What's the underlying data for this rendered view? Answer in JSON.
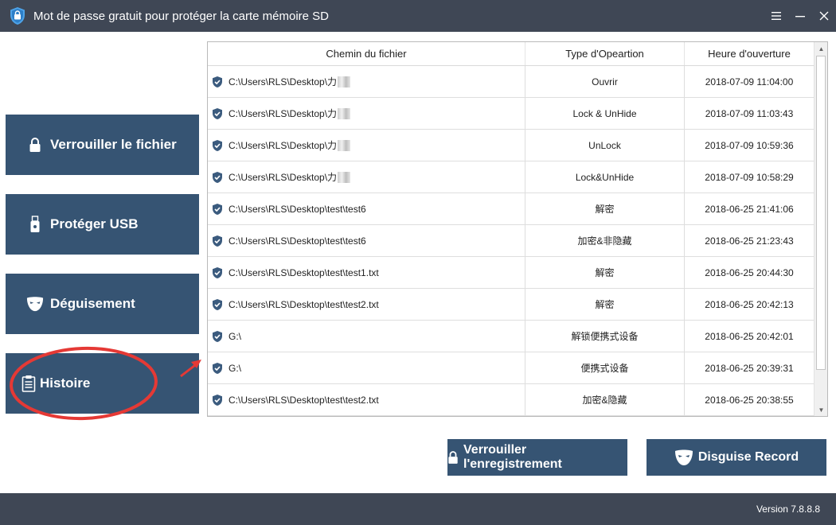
{
  "window": {
    "title": "Mot de passe gratuit pour protéger la carte mémoire SD",
    "icon": "shield-folder-icon",
    "controls": {
      "menu": "≡",
      "minimize": "—",
      "close": "✕"
    }
  },
  "sidebar": {
    "items": [
      {
        "label": "Verrouiller le fichier",
        "icon": "lock-icon"
      },
      {
        "label": "Protéger USB",
        "icon": "usb-icon"
      },
      {
        "label": "Déguisement",
        "icon": "mask-icon"
      },
      {
        "label": "Histoire",
        "icon": "clipboard-icon",
        "selected": true
      }
    ]
  },
  "table": {
    "headers": {
      "path": "Chemin du fichier",
      "type": "Type d'Opeartion",
      "time": "Heure d'ouverture"
    },
    "rows": [
      {
        "path": "C:\\Users\\RLS\\Desktop\\力",
        "type": "Ouvrir",
        "time": "2018-07-09 11:04:00",
        "blurred": true
      },
      {
        "path": "C:\\Users\\RLS\\Desktop\\力",
        "type": "Lock & UnHide",
        "time": "2018-07-09 11:03:43",
        "blurred": true
      },
      {
        "path": "C:\\Users\\RLS\\Desktop\\力",
        "type": "UnLock",
        "time": "2018-07-09 10:59:36",
        "blurred": true
      },
      {
        "path": "C:\\Users\\RLS\\Desktop\\力",
        "type": "Lock&UnHide",
        "time": "2018-07-09 10:58:29",
        "blurred": true
      },
      {
        "path": "C:\\Users\\RLS\\Desktop\\test\\test6",
        "type": "解密",
        "time": "2018-06-25 21:41:06"
      },
      {
        "path": "C:\\Users\\RLS\\Desktop\\test\\test6",
        "type": "加密&非隐藏",
        "time": "2018-06-25 21:23:43"
      },
      {
        "path": "C:\\Users\\RLS\\Desktop\\test\\test1.txt",
        "type": "解密",
        "time": "2018-06-25 20:44:30"
      },
      {
        "path": "C:\\Users\\RLS\\Desktop\\test\\test2.txt",
        "type": "解密",
        "time": "2018-06-25 20:42:13"
      },
      {
        "path": "G:\\",
        "type": "解锁便携式设备",
        "time": "2018-06-25 20:42:01"
      },
      {
        "path": "G:\\",
        "type": "便携式设备",
        "time": "2018-06-25 20:39:31"
      },
      {
        "path": "C:\\Users\\RLS\\Desktop\\test\\test2.txt",
        "type": "加密&隐藏",
        "time": "2018-06-25 20:38:55"
      }
    ]
  },
  "actions": {
    "lock_record": {
      "label": "Verrouiller l'enregistrement",
      "icon": "lock-icon"
    },
    "disguise_record": {
      "label": "Disguise Record",
      "icon": "mask-icon"
    }
  },
  "footer": {
    "version": "Version 7.8.8.8"
  },
  "colors": {
    "titlebar": "#3f4755",
    "button": "#365473",
    "annotation": "#e53935",
    "shield": "#3b5b7e"
  }
}
